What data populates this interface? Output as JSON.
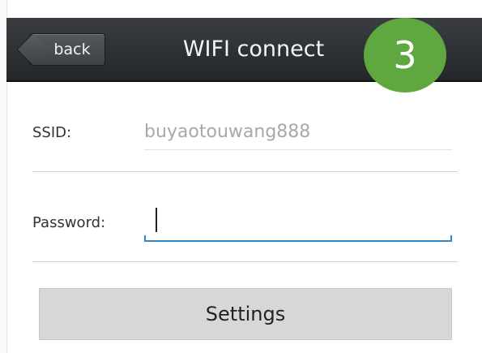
{
  "header": {
    "back_label": "back",
    "title": "WIFI connect",
    "step_number": "3"
  },
  "form": {
    "ssid_label": "SSID:",
    "ssid_value": "buyaotouwang888",
    "password_label": "Password:",
    "password_value": ""
  },
  "actions": {
    "settings_label": "Settings"
  },
  "colors": {
    "header": "#2e3134",
    "badge": "#5fa83f",
    "input_focus": "#2f86c6",
    "button": "#d7d7d7"
  }
}
